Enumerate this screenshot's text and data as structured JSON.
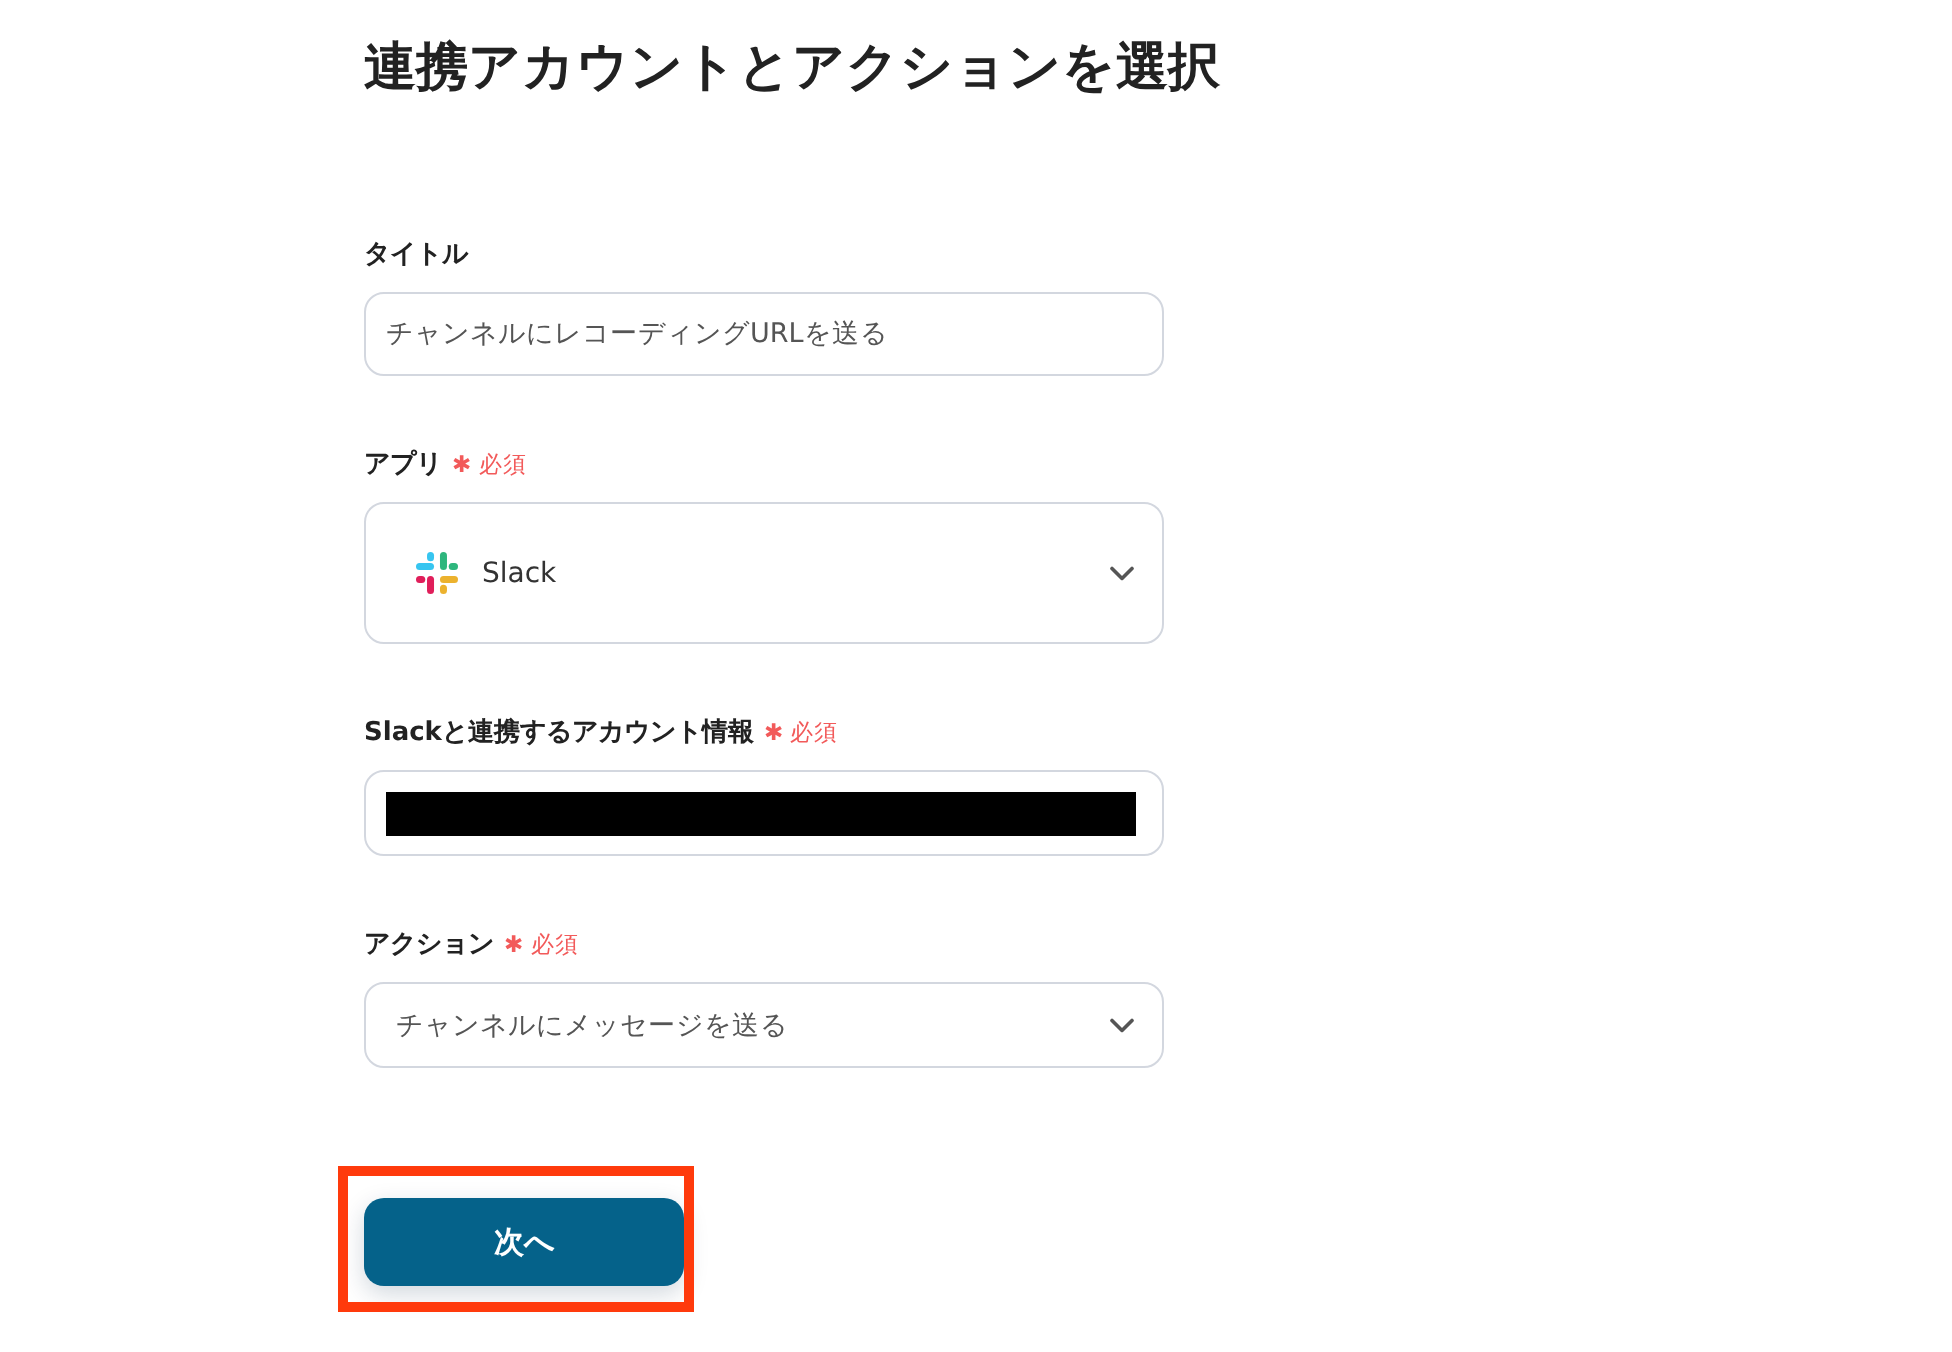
{
  "heading": "連携アカウントとアクションを選択",
  "fields": [
    {
      "kind": "text",
      "label": "タイトル",
      "value": "チャンネルにレコーディングURLを送る"
    },
    {
      "kind": "app-select",
      "label": "アプリ",
      "required_tag": "✱ 必須",
      "value": "Slack"
    },
    {
      "kind": "account",
      "label": "Slackと連携するアカウント情報",
      "required_tag": "✱ 必須",
      "redacted": true
    },
    {
      "kind": "select",
      "label": "アクション",
      "required_tag": "✱ 必須",
      "value": "チャンネルにメッセージを送る"
    }
  ],
  "next_button": {
    "label": "次へ",
    "highlighted": true
  }
}
